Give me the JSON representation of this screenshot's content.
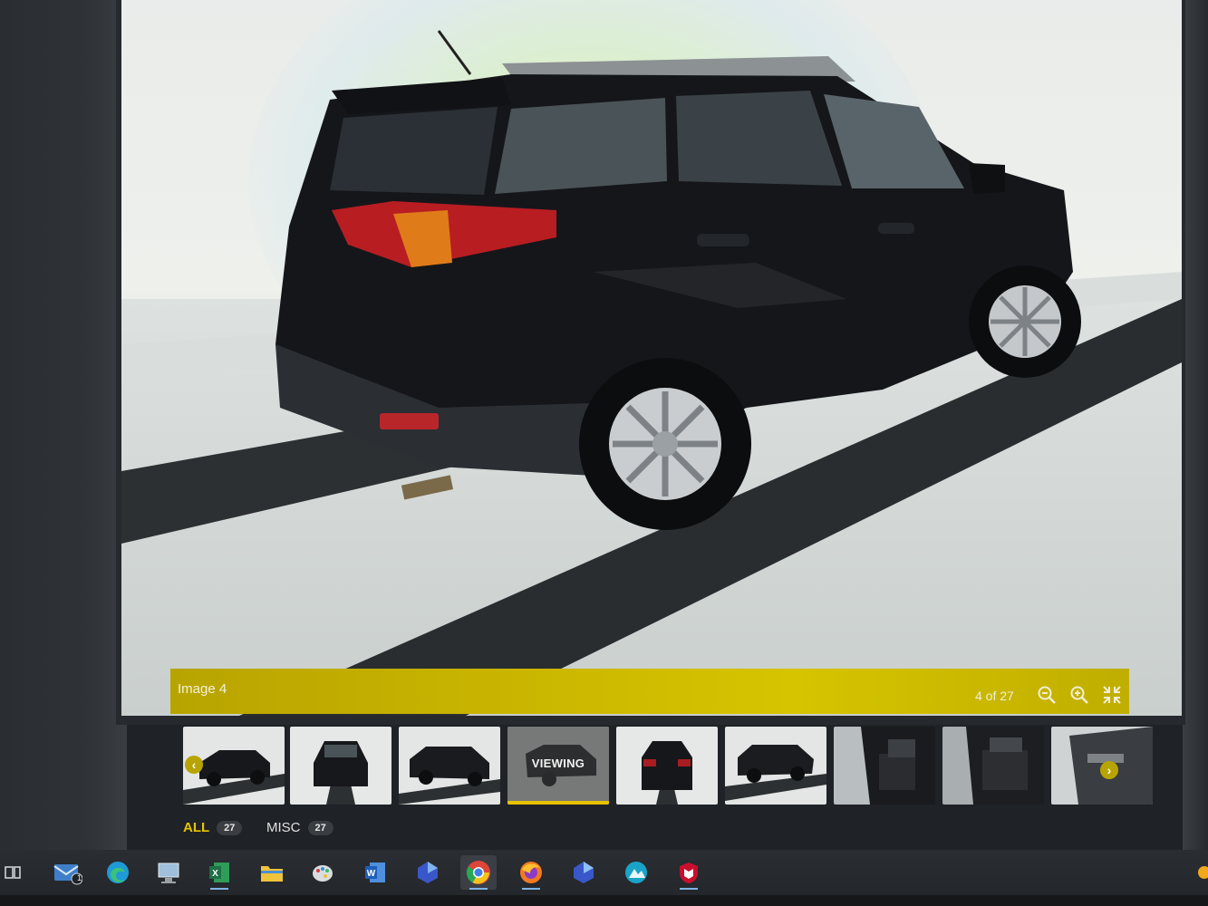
{
  "viewer": {
    "caption": "Image 4",
    "counter": "4 of 27",
    "zoom_out_label": "zoom out",
    "zoom_in_label": "zoom in",
    "exit_fullscreen_label": "exit fullscreen"
  },
  "thumbnails": {
    "viewing_label": "VIEWING",
    "items": [
      {
        "icon": "suv-front-three-quarter"
      },
      {
        "icon": "suv-front"
      },
      {
        "icon": "suv-front-three-quarter-right"
      },
      {
        "icon": "suv-rear-three-quarter",
        "state": "viewing"
      },
      {
        "icon": "suv-rear"
      },
      {
        "icon": "suv-rear-side"
      },
      {
        "icon": "interior-front"
      },
      {
        "icon": "interior-rear"
      },
      {
        "icon": "door-panel"
      }
    ]
  },
  "filters": [
    {
      "label": "ALL",
      "count": "27",
      "active": true
    },
    {
      "label": "MISC",
      "count": "27",
      "active": false
    }
  ],
  "taskbar": {
    "mail_badge": "1",
    "apps": [
      "task-view",
      "mail",
      "edge",
      "network-computer",
      "excel",
      "file-explorer",
      "paint",
      "word",
      "app-blue-1",
      "chrome",
      "firefox",
      "app-blue-2",
      "app-teal",
      "mcafee"
    ]
  },
  "colors": {
    "accent_yellow": "#c9b500",
    "viewing_underline": "#e8c200",
    "active_filter": "#e6c400"
  }
}
